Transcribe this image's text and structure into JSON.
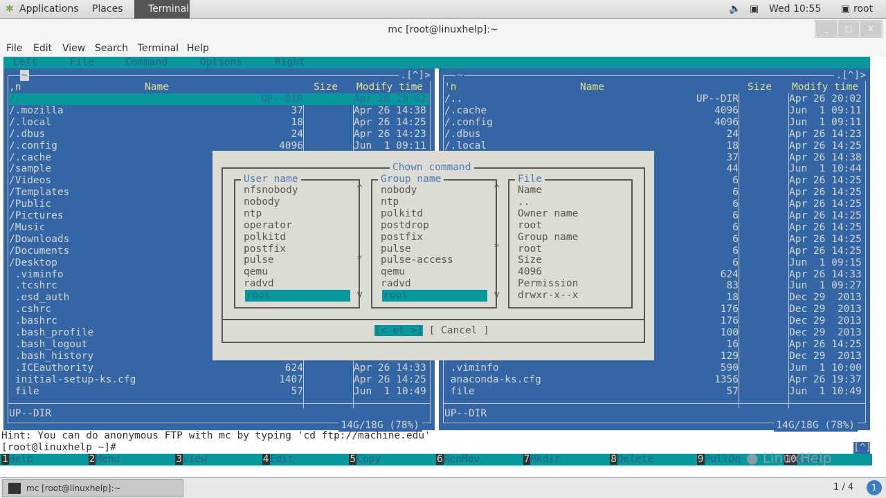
{
  "topbar": {
    "applications": "Applications",
    "places": "Places",
    "terminal": "Terminal",
    "clock": "Wed 10:55",
    "user": "root"
  },
  "window": {
    "title": "mc [root@linuxhelp]:~",
    "controls": [
      "_",
      "□",
      "X"
    ]
  },
  "menu": [
    "File",
    "Edit",
    "View",
    "Search",
    "Terminal",
    "Help"
  ],
  "mc_menu": [
    "Left",
    "File",
    "Command",
    "Options",
    "Right"
  ],
  "left_panel": {
    "path": "~",
    "sort": ",n",
    "scroll": ".[^]>",
    "headers": {
      "name": "Name",
      "size": "Size",
      "time": "Modify time"
    },
    "rows": [
      {
        "name": "/..",
        "size": "UP--DIR",
        "time": "Apr 26 20:02",
        "selected": true
      },
      {
        "name": "/.mozilla",
        "size": "37",
        "time": "Apr 26 14:38"
      },
      {
        "name": "/.local",
        "size": "18",
        "time": "Apr 26 14:25"
      },
      {
        "name": "/.dbus",
        "size": "24",
        "time": "Apr 26 14:23"
      },
      {
        "name": "/.config",
        "size": "4096",
        "time": "Jun  1 09:11"
      },
      {
        "name": "/.cache",
        "size": "",
        "time": ""
      },
      {
        "name": "/sample",
        "size": "",
        "time": ""
      },
      {
        "name": "/Videos",
        "size": "",
        "time": ""
      },
      {
        "name": "/Templates",
        "size": "",
        "time": ""
      },
      {
        "name": "/Public",
        "size": "",
        "time": ""
      },
      {
        "name": "/Pictures",
        "size": "",
        "time": ""
      },
      {
        "name": "/Music",
        "size": "",
        "time": ""
      },
      {
        "name": "/Downloads",
        "size": "",
        "time": ""
      },
      {
        "name": "/Documents",
        "size": "",
        "time": ""
      },
      {
        "name": "/Desktop",
        "size": "",
        "time": ""
      },
      {
        "name": " .viminfo",
        "size": "",
        "time": ""
      },
      {
        "name": " .tcshrc",
        "size": "",
        "time": ""
      },
      {
        "name": " .esd_auth",
        "size": "",
        "time": ""
      },
      {
        "name": " .cshrc",
        "size": "",
        "time": ""
      },
      {
        "name": " .bashrc",
        "size": "",
        "time": ""
      },
      {
        "name": " .bash_profile",
        "size": "",
        "time": ""
      },
      {
        "name": " .bash_logout",
        "size": "",
        "time": ""
      },
      {
        "name": " .bash_history",
        "size": "",
        "time": ""
      },
      {
        "name": " .ICEauthority",
        "size": "624",
        "time": "Apr 26 14:33"
      },
      {
        "name": " initial-setup-ks.cfg",
        "size": "1407",
        "time": "Apr 26 14:25"
      },
      {
        "name": " file",
        "size": "57",
        "time": "Jun  1 10:49"
      }
    ],
    "mini_status": "UP--DIR",
    "free": "14G/18G (78%)"
  },
  "right_panel": {
    "path": "~",
    "sort": "'n",
    "scroll": ".[^]>",
    "headers": {
      "name": "Name",
      "size": "Size",
      "time": "Modify time"
    },
    "rows": [
      {
        "name": "/..",
        "size": "UP--DIR",
        "time": "Apr 26 20:02"
      },
      {
        "name": "/.cache",
        "size": "4096",
        "time": "Jun  1 09:11"
      },
      {
        "name": "/.config",
        "size": "4096",
        "time": "Jun  1 09:11"
      },
      {
        "name": "/.dbus",
        "size": "24",
        "time": "Apr 26 14:23"
      },
      {
        "name": "/.local",
        "size": "18",
        "time": "Apr 26 14:25"
      },
      {
        "name": "",
        "size": "37",
        "time": "Apr 26 14:38"
      },
      {
        "name": "",
        "size": "44",
        "time": "Jun  1 10:44"
      },
      {
        "name": "",
        "size": "6",
        "time": "Apr 26 14:25"
      },
      {
        "name": "",
        "size": "6",
        "time": "Apr 26 14:25"
      },
      {
        "name": "",
        "size": "6",
        "time": "Apr 26 14:25"
      },
      {
        "name": "",
        "size": "6",
        "time": "Apr 26 14:25"
      },
      {
        "name": "",
        "size": "6",
        "time": "Apr 26 14:25"
      },
      {
        "name": "",
        "size": "6",
        "time": "Apr 26 14:25"
      },
      {
        "name": "",
        "size": "6",
        "time": "Apr 26 14:25"
      },
      {
        "name": "",
        "size": "6",
        "time": "Jun  1 09:15"
      },
      {
        "name": "",
        "size": "624",
        "time": "Apr 26 14:33"
      },
      {
        "name": "",
        "size": "83",
        "time": "Jun  1 09:27"
      },
      {
        "name": "",
        "size": "18",
        "time": "Dec 29  2013"
      },
      {
        "name": "",
        "size": "176",
        "time": "Dec 29  2013"
      },
      {
        "name": "",
        "size": "176",
        "time": "Dec 29  2013"
      },
      {
        "name": "",
        "size": "100",
        "time": "Dec 29  2013"
      },
      {
        "name": "",
        "size": "16",
        "time": "Apr 26 14:25"
      },
      {
        "name": "",
        "size": "129",
        "time": "Dec 29  2013"
      },
      {
        "name": " .viminfo",
        "size": "590",
        "time": "Jun  1 10:00"
      },
      {
        "name": " anaconda-ks.cfg",
        "size": "1356",
        "time": "Apr 26 19:37"
      },
      {
        "name": " file",
        "size": "57",
        "time": "Jun  1 10:49"
      }
    ],
    "mini_status": "UP--DIR",
    "free": "14G/18G (78%)"
  },
  "dialog": {
    "title": "Chown command",
    "user": {
      "title": "User name",
      "items": [
        "nfsnobody",
        "nobody",
        "ntp",
        "operator",
        "polkitd",
        "postfix",
        "pulse",
        "qemu",
        "radvd",
        "root"
      ],
      "selected": "root"
    },
    "group": {
      "title": "Group name",
      "items": [
        "nobody",
        "ntp",
        "polkitd",
        "postdrop",
        "postfix",
        "pulse",
        "pulse-access",
        "qemu",
        "radvd",
        "root"
      ],
      "selected": "root"
    },
    "file": {
      "title": "File",
      "items": [
        "Name",
        "..",
        "Owner name",
        "root",
        "Group name",
        "root",
        "Size",
        "4096",
        "Permission",
        "drwxr-x--x"
      ]
    },
    "set_button": "[< et >]",
    "cancel_button": "[ Cancel ]"
  },
  "hint": "Hint: You can do anonymous FTP with mc by typing 'cd ftp://machine.edu'",
  "prompt": "[root@linuxhelp ~]#",
  "scroll_indicator": "[^]",
  "fkeys": [
    {
      "n": "1",
      "l": "Help"
    },
    {
      "n": "2",
      "l": "Menu"
    },
    {
      "n": "3",
      "l": "View"
    },
    {
      "n": "4",
      "l": "Edit"
    },
    {
      "n": "5",
      "l": "Copy"
    },
    {
      "n": "6",
      "l": "RenMov"
    },
    {
      "n": "7",
      "l": "Mkdir"
    },
    {
      "n": "8",
      "l": "Delete"
    },
    {
      "n": "9",
      "l": "PullDn"
    },
    {
      "n": "10",
      "l": "Quit"
    }
  ],
  "watermark": "LinuxHelp",
  "taskbar": {
    "task": "mc [root@linuxhelp]:~",
    "workspace": "1 / 4",
    "notifications": "1"
  }
}
